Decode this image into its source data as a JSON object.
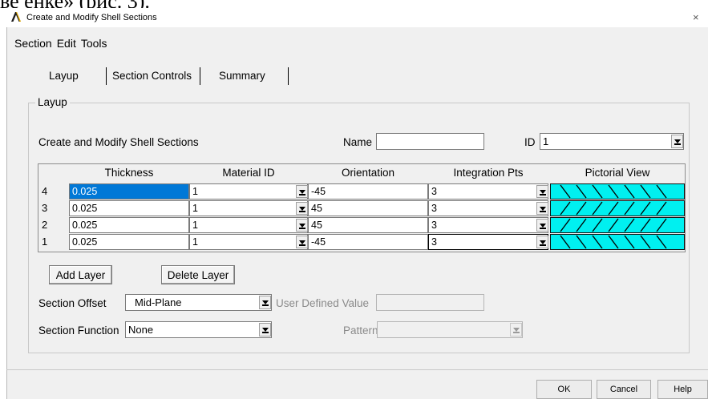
{
  "doc_fragment": "ве            ёнке» (рис. 3).",
  "window": {
    "title": "Create and Modify Shell Sections",
    "close_symbol": "×"
  },
  "menu": [
    "Section",
    "Edit",
    "Tools"
  ],
  "tabs": [
    "Layup",
    "Section Controls",
    "Summary"
  ],
  "group": {
    "legend": "Layup",
    "caption": "Create and Modify Shell Sections",
    "name_label": "Name",
    "name_value": "",
    "id_label": "ID",
    "id_value": "1"
  },
  "table": {
    "headers": [
      "Thickness",
      "Material ID",
      "Orientation",
      "Integration Pts",
      "Pictorial View"
    ],
    "rows": [
      {
        "num": "4",
        "thickness": "0.025",
        "material": "1",
        "orientation": "-45",
        "intpts": "3",
        "pattern": "back"
      },
      {
        "num": "3",
        "thickness": "0.025",
        "material": "1",
        "orientation": "45",
        "intpts": "3",
        "pattern": "fwd"
      },
      {
        "num": "2",
        "thickness": "0.025",
        "material": "1",
        "orientation": "45",
        "intpts": "3",
        "pattern": "fwd"
      },
      {
        "num": "1",
        "thickness": "0.025",
        "material": "1",
        "orientation": "-45",
        "intpts": "3",
        "pattern": "back"
      }
    ],
    "pictorial_color": "#00f0f0",
    "selected_cell_color": "#0078d7"
  },
  "buttons": {
    "add_layer": "Add Layer",
    "delete_layer": "Delete Layer",
    "ok": "OK",
    "cancel": "Cancel",
    "help": "Help"
  },
  "section_offset": {
    "label": "Section Offset",
    "value": "Mid-Plane",
    "user_defined_label": "User Defined Value",
    "user_defined_value": ""
  },
  "section_function": {
    "label": "Section Function",
    "value": "None",
    "pattern_label": "Pattern",
    "pattern_value": ""
  },
  "icons": {
    "app": "ansys-logo-icon",
    "dropdown": "chevron-down-icon",
    "close": "close-icon"
  }
}
